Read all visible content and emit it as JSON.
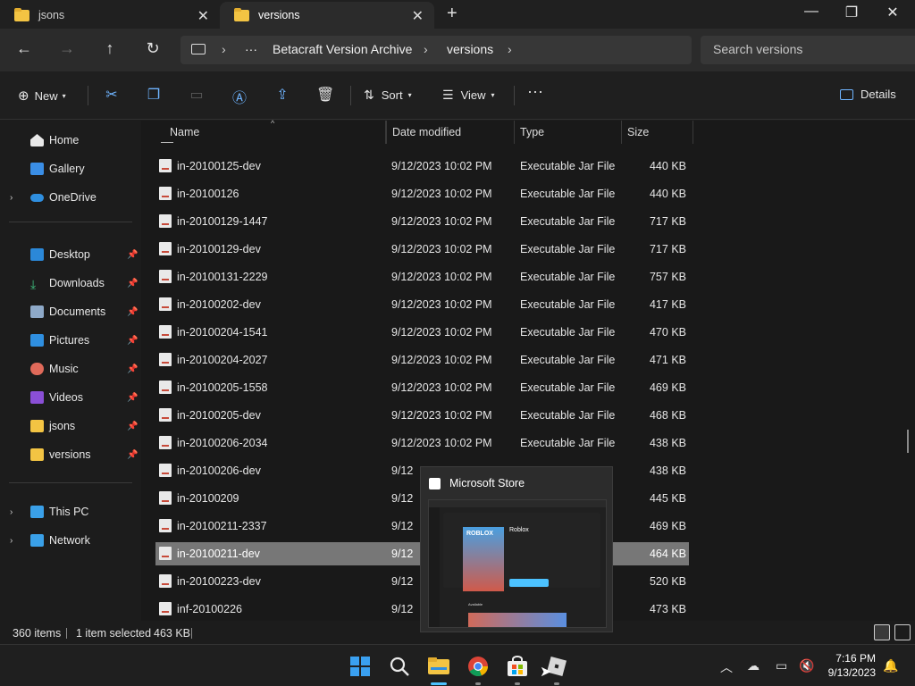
{
  "tabs": [
    {
      "label": "jsons"
    },
    {
      "label": "versions"
    }
  ],
  "address": {
    "crumbs": [
      "Betacraft Version Archive",
      "versions"
    ],
    "more": "···"
  },
  "search": {
    "placeholder": "Search versions"
  },
  "toolbar": {
    "new_label": "New",
    "sort_label": "Sort",
    "view_label": "View",
    "more_label": "···",
    "details_label": "Details"
  },
  "sidebar": {
    "top": [
      {
        "label": "Home",
        "icon": "home-icon"
      },
      {
        "label": "Gallery",
        "icon": "gallery-icon"
      },
      {
        "label": "OneDrive",
        "icon": "onedrive-icon"
      }
    ],
    "pinned": [
      {
        "label": "Desktop",
        "icon": "desktop-icon"
      },
      {
        "label": "Downloads",
        "icon": "downloads-icon"
      },
      {
        "label": "Documents",
        "icon": "documents-icon"
      },
      {
        "label": "Pictures",
        "icon": "pictures-icon"
      },
      {
        "label": "Music",
        "icon": "music-icon"
      },
      {
        "label": "Videos",
        "icon": "videos-icon"
      },
      {
        "label": "jsons",
        "icon": "folder-icon"
      },
      {
        "label": "versions",
        "icon": "folder-icon"
      }
    ],
    "bottom": [
      {
        "label": "This PC",
        "icon": "pc-icon"
      },
      {
        "label": "Network",
        "icon": "network-icon"
      }
    ]
  },
  "columns": {
    "name": "Name",
    "date": "Date modified",
    "type": "Type",
    "size": "Size"
  },
  "files": [
    {
      "name": "in-20100125-dev",
      "date": "9/12/2023 10:02 PM",
      "type": "Executable Jar File",
      "size": "440 KB"
    },
    {
      "name": "in-20100126",
      "date": "9/12/2023 10:02 PM",
      "type": "Executable Jar File",
      "size": "440 KB"
    },
    {
      "name": "in-20100129-1447",
      "date": "9/12/2023 10:02 PM",
      "type": "Executable Jar File",
      "size": "717 KB"
    },
    {
      "name": "in-20100129-dev",
      "date": "9/12/2023 10:02 PM",
      "type": "Executable Jar File",
      "size": "717 KB"
    },
    {
      "name": "in-20100131-2229",
      "date": "9/12/2023 10:02 PM",
      "type": "Executable Jar File",
      "size": "757 KB"
    },
    {
      "name": "in-20100202-dev",
      "date": "9/12/2023 10:02 PM",
      "type": "Executable Jar File",
      "size": "417 KB"
    },
    {
      "name": "in-20100204-1541",
      "date": "9/12/2023 10:02 PM",
      "type": "Executable Jar File",
      "size": "470 KB"
    },
    {
      "name": "in-20100204-2027",
      "date": "9/12/2023 10:02 PM",
      "type": "Executable Jar File",
      "size": "471 KB"
    },
    {
      "name": "in-20100205-1558",
      "date": "9/12/2023 10:02 PM",
      "type": "Executable Jar File",
      "size": "469 KB"
    },
    {
      "name": "in-20100205-dev",
      "date": "9/12/2023 10:02 PM",
      "type": "Executable Jar File",
      "size": "468 KB"
    },
    {
      "name": "in-20100206-2034",
      "date": "9/12/2023 10:02 PM",
      "type": "Executable Jar File",
      "size": "438 KB"
    },
    {
      "name": "in-20100206-dev",
      "date": "9/12",
      "type": "",
      "size": "438 KB"
    },
    {
      "name": "in-20100209",
      "date": "9/12",
      "type": "",
      "size": "445 KB"
    },
    {
      "name": "in-20100211-2337",
      "date": "9/12",
      "type": "",
      "size": "469 KB"
    },
    {
      "name": "in-20100211-dev",
      "date": "9/12",
      "type": "",
      "size": "464 KB",
      "selected": true
    },
    {
      "name": "in-20100223-dev",
      "date": "9/12",
      "type": "",
      "size": "520 KB"
    },
    {
      "name": "inf-20100226",
      "date": "9/12",
      "type": "",
      "size": "473 KB"
    }
  ],
  "status": {
    "items": "360 items",
    "selected": "1 item selected",
    "sel_size": "463 KB"
  },
  "preview": {
    "title": "Microsoft Store",
    "app_name": "Roblox",
    "logo_text": "ROBLOX",
    "section": "Available"
  },
  "clock": {
    "time": "7:16 PM",
    "date": "9/13/2023"
  },
  "colors": {
    "accent": "#4cc2ff",
    "selection": "#777777",
    "folder": "#f3c443"
  }
}
